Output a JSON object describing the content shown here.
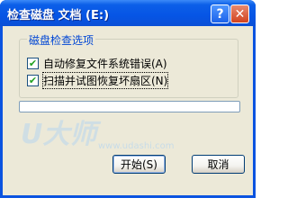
{
  "window": {
    "title": "检查磁盘 文档 (E:)",
    "help_label": "?",
    "close_label": "✕"
  },
  "options_group": {
    "legend": "磁盘检查选项",
    "items": [
      {
        "label": "自动修复文件系统错误(A)",
        "checked": true
      },
      {
        "label": "扫描并试图恢复坏扇区(N)",
        "checked": true
      }
    ]
  },
  "progress": {
    "value": 0
  },
  "watermark": {
    "logo": "U大师",
    "url": "www.udashi.com"
  },
  "buttons": {
    "start_label": "开始(S)",
    "cancel_label": "取消"
  },
  "colors": {
    "title_bar": "#0655e5",
    "client_bg": "#ece9d8",
    "legend_text": "#0046d5",
    "check_mark": "#21a121",
    "close_button": "#d2431f"
  }
}
